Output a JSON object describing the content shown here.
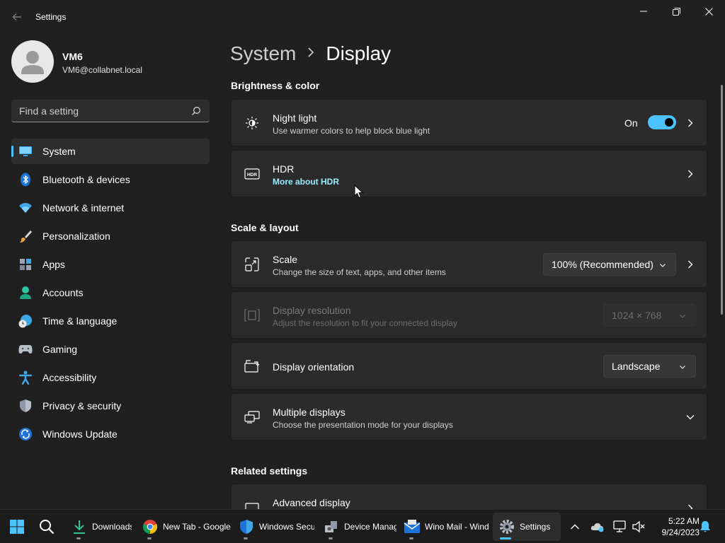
{
  "window": {
    "title": "Settings"
  },
  "user": {
    "name": "VM6",
    "email": "VM6@collabnet.local"
  },
  "search": {
    "placeholder": "Find a setting"
  },
  "nav": [
    {
      "label": "System",
      "icon": "system-icon",
      "selected": true
    },
    {
      "label": "Bluetooth & devices",
      "icon": "bluetooth-icon"
    },
    {
      "label": "Network & internet",
      "icon": "wifi-icon"
    },
    {
      "label": "Personalization",
      "icon": "brush-icon"
    },
    {
      "label": "Apps",
      "icon": "apps-icon"
    },
    {
      "label": "Accounts",
      "icon": "accounts-icon"
    },
    {
      "label": "Time & language",
      "icon": "globe-clock-icon"
    },
    {
      "label": "Gaming",
      "icon": "gamepad-icon"
    },
    {
      "label": "Accessibility",
      "icon": "accessibility-icon"
    },
    {
      "label": "Privacy & security",
      "icon": "shield-icon"
    },
    {
      "label": "Windows Update",
      "icon": "update-icon"
    }
  ],
  "breadcrumb": {
    "parent": "System",
    "current": "Display"
  },
  "sections": {
    "brightness": "Brightness & color",
    "scale_layout": "Scale & layout",
    "related": "Related settings"
  },
  "cards": {
    "night_light": {
      "title": "Night light",
      "subtitle": "Use warmer colors to help block blue light",
      "toggle_label": "On",
      "toggle_on": true
    },
    "hdr": {
      "title": "HDR",
      "link": "More about HDR"
    },
    "scale": {
      "title": "Scale",
      "subtitle": "Change the size of text, apps, and other items",
      "value": "100% (Recommended)"
    },
    "resolution": {
      "title": "Display resolution",
      "subtitle": "Adjust the resolution to fit your connected display",
      "value": "1024 × 768"
    },
    "orientation": {
      "title": "Display orientation",
      "value": "Landscape"
    },
    "multiple": {
      "title": "Multiple displays",
      "subtitle": "Choose the presentation mode for your displays"
    },
    "advanced": {
      "title": "Advanced display"
    }
  },
  "taskbar": {
    "apps": [
      {
        "label": "Downloads",
        "icon": "download-icon"
      },
      {
        "label": "New Tab - Google Chrome",
        "icon": "chrome-icon"
      },
      {
        "label": "Windows Security",
        "icon": "windows-security-icon"
      },
      {
        "label": "Device Manager",
        "icon": "device-manager-icon"
      },
      {
        "label": "Wino Mail - Windows",
        "icon": "mail-icon"
      },
      {
        "label": "Settings",
        "icon": "settings-gear-icon",
        "active": true
      }
    ],
    "time": "5:22 AM",
    "date": "9/24/2023"
  },
  "colors": {
    "accent": "#4cc2ff",
    "background": "#202020",
    "card": "#2b2b2b",
    "link": "#99ebff"
  }
}
